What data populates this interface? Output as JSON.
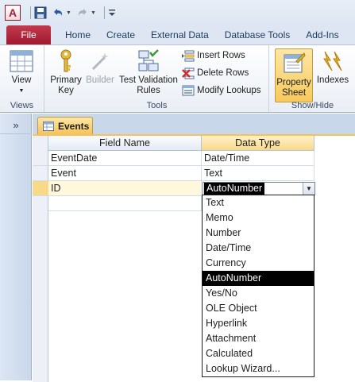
{
  "quick_access": {
    "app_letter": "A"
  },
  "ribbon_tabs": [
    {
      "label": "File"
    },
    {
      "label": "Home"
    },
    {
      "label": "Create"
    },
    {
      "label": "External Data"
    },
    {
      "label": "Database Tools"
    },
    {
      "label": "Add-Ins"
    }
  ],
  "ribbon": {
    "views_group": {
      "label": "Views",
      "view_button": "View"
    },
    "tools_group": {
      "label": "Tools",
      "primary_key": "Primary Key",
      "builder": "Builder",
      "test_validation": "Test Validation Rules",
      "insert_rows": "Insert Rows",
      "delete_rows": "Delete Rows",
      "modify_lookups": "Modify Lookups"
    },
    "showhide_group": {
      "label": "Show/Hide",
      "property_sheet": "Property Sheet",
      "indexes": "Indexes"
    }
  },
  "nav_pane": {
    "toggle": "»"
  },
  "document": {
    "tab_title": "Events",
    "columns": {
      "field_name": "Field Name",
      "data_type": "Data Type"
    },
    "rows": [
      {
        "field": "EventDate",
        "type": "Date/Time"
      },
      {
        "field": "Event",
        "type": "Text"
      },
      {
        "field": "ID",
        "type": "AutoNumber"
      }
    ]
  },
  "data_type_dropdown": {
    "selected": "AutoNumber",
    "options": [
      "Text",
      "Memo",
      "Number",
      "Date/Time",
      "Currency",
      "AutoNumber",
      "Yes/No",
      "OLE Object",
      "Hyperlink",
      "Attachment",
      "Calculated",
      "Lookup Wizard..."
    ]
  },
  "colors": {
    "file_tab": "#a0192f",
    "accent_gold": "#f6c35a",
    "selection": "#000000"
  }
}
